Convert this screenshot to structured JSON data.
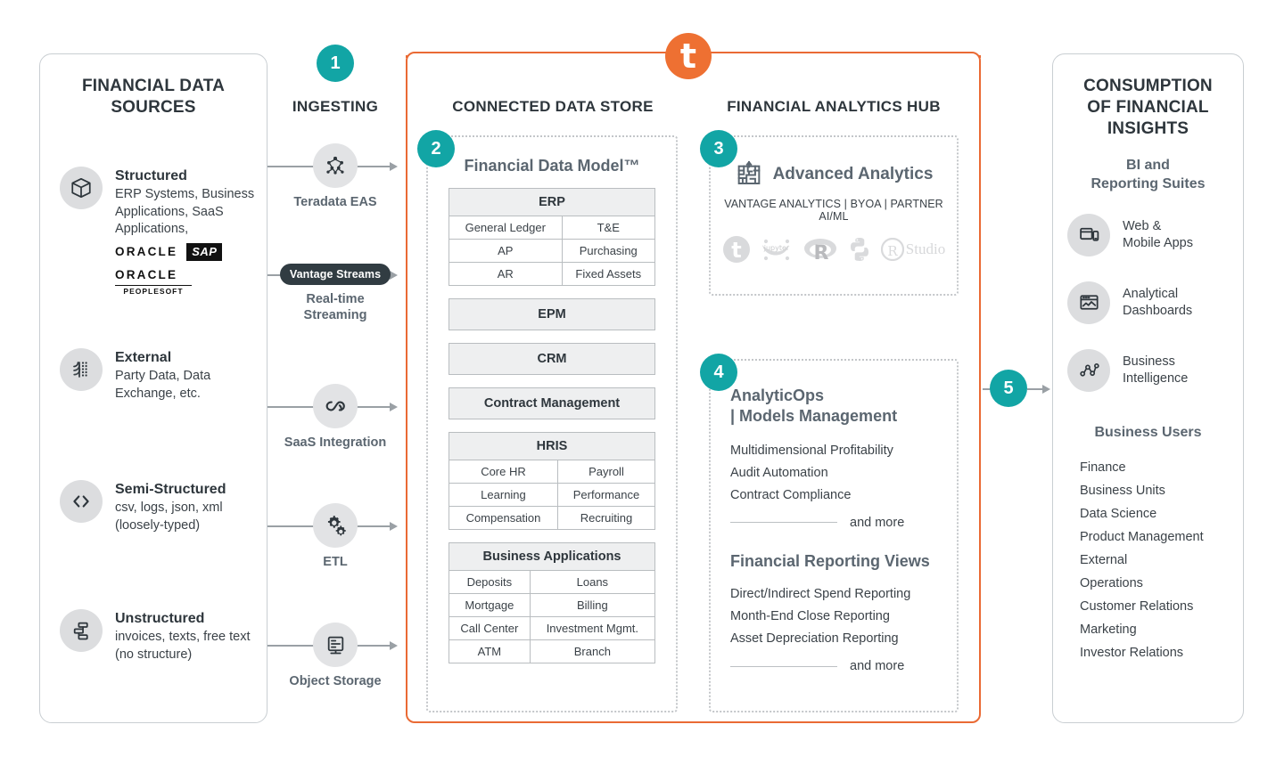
{
  "colors": {
    "teal": "#12a5a5",
    "orange": "#ea6a34",
    "logo_orange": "#ee7032",
    "grey_icon_bg": "#dcdddf",
    "panel_border": "#c9ced2"
  },
  "brand": {
    "logo_letter": "t",
    "logo_name": "teradata-logo"
  },
  "sources": {
    "title": "FINANCIAL DATA\nSOURCES",
    "items": [
      {
        "heading": "Structured",
        "desc": "ERP Systems, Business Applications, SaaS Applications,",
        "icon": "box-icon",
        "logos": [
          "ORACLE",
          "SAP",
          "ORACLE",
          "PEOPLESOFT"
        ]
      },
      {
        "heading": "External",
        "desc": "Party Data, Data Exchange, etc.",
        "icon": "external-data-icon"
      },
      {
        "heading": "Semi-Structured",
        "desc": "csv, logs, json, xml (loosely-typed)",
        "icon": "code-brackets-icon"
      },
      {
        "heading": "Unstructured",
        "desc": "invoices, texts, free text (no structure)",
        "icon": "documents-icon"
      }
    ]
  },
  "ingesting": {
    "step": "1",
    "title": "INGESTING",
    "nodes": [
      {
        "label": "Teradata EAS",
        "icon": "nodes-network-icon",
        "type": "icon"
      },
      {
        "label": "Real-time\nStreaming",
        "pill": "Vantage Streams",
        "type": "pill"
      },
      {
        "label": "SaaS Integration",
        "icon": "infinity-link-icon",
        "type": "icon"
      },
      {
        "label": "ETL",
        "icon": "gears-icon",
        "type": "icon"
      },
      {
        "label": "Object Storage",
        "icon": "server-storage-icon",
        "type": "icon"
      }
    ]
  },
  "connected_data_store": {
    "title": "CONNECTED DATA STORE",
    "step": "2",
    "model_title": "Financial Data Model™",
    "groups": [
      {
        "name": "ERP",
        "rows": [
          [
            "General Ledger",
            "T&E"
          ],
          [
            "AP",
            "Purchasing"
          ],
          [
            "AR",
            "Fixed Assets"
          ]
        ]
      },
      {
        "name": "EPM",
        "rows": []
      },
      {
        "name": "CRM",
        "rows": []
      },
      {
        "name": "Contract Management",
        "rows": []
      },
      {
        "name": "HRIS",
        "rows": [
          [
            "Core HR",
            "Payroll"
          ],
          [
            "Learning",
            "Performance"
          ],
          [
            "Compensation",
            "Recruiting"
          ]
        ]
      },
      {
        "name": "Business Applications",
        "rows": [
          [
            "Deposits",
            "Loans"
          ],
          [
            "Mortgage",
            "Billing"
          ],
          [
            "Call Center",
            "Investment Mgmt."
          ],
          [
            "ATM",
            "Branch"
          ]
        ]
      }
    ]
  },
  "analytics_hub": {
    "title": "FINANCIAL ANALYTICS HUB",
    "advanced": {
      "step": "3",
      "heading": "Advanced Analytics",
      "icon": "maze-circuit-icon",
      "subtitle": "VANTAGE ANALYTICS | BYOA | PARTNER AI/ML",
      "logos": [
        "teradata-logo",
        "jupyter-logo",
        "r-logo",
        "python-logo",
        "rstudio-logo"
      ],
      "rstudio_text": "Studio",
      "jupyter_text": "jupyter",
      "r_text": "R"
    },
    "analyticops": {
      "step": "4",
      "heading_line1": "AnalyticOps",
      "heading_line2": "| Models Management",
      "items": [
        "Multidimensional Profitability",
        "Audit Automation",
        "Contract Compliance"
      ],
      "and_more": "and more",
      "reporting_heading": "Financial Reporting Views",
      "reporting_items": [
        "Direct/Indirect Spend Reporting",
        "Month-End Close Reporting",
        "Asset Depreciation Reporting"
      ],
      "reporting_and_more": "and more"
    }
  },
  "consumption": {
    "step": "5",
    "title": "CONSUMPTION\nOF FINANCIAL\nINSIGHTS",
    "bi_heading": "BI and\nReporting Suites",
    "bi_items": [
      {
        "label": "Web &\nMobile Apps",
        "icon": "web-mobile-icon"
      },
      {
        "label": "Analytical\nDashboards",
        "icon": "dashboard-chart-icon"
      },
      {
        "label": "Business\nIntelligence",
        "icon": "network-graph-icon"
      }
    ],
    "users_heading": "Business Users",
    "users": [
      "Finance",
      "Business Units",
      "Data Science",
      "Product Management",
      "External",
      "Operations",
      "Customer Relations",
      "Marketing",
      "Investor Relations"
    ]
  }
}
